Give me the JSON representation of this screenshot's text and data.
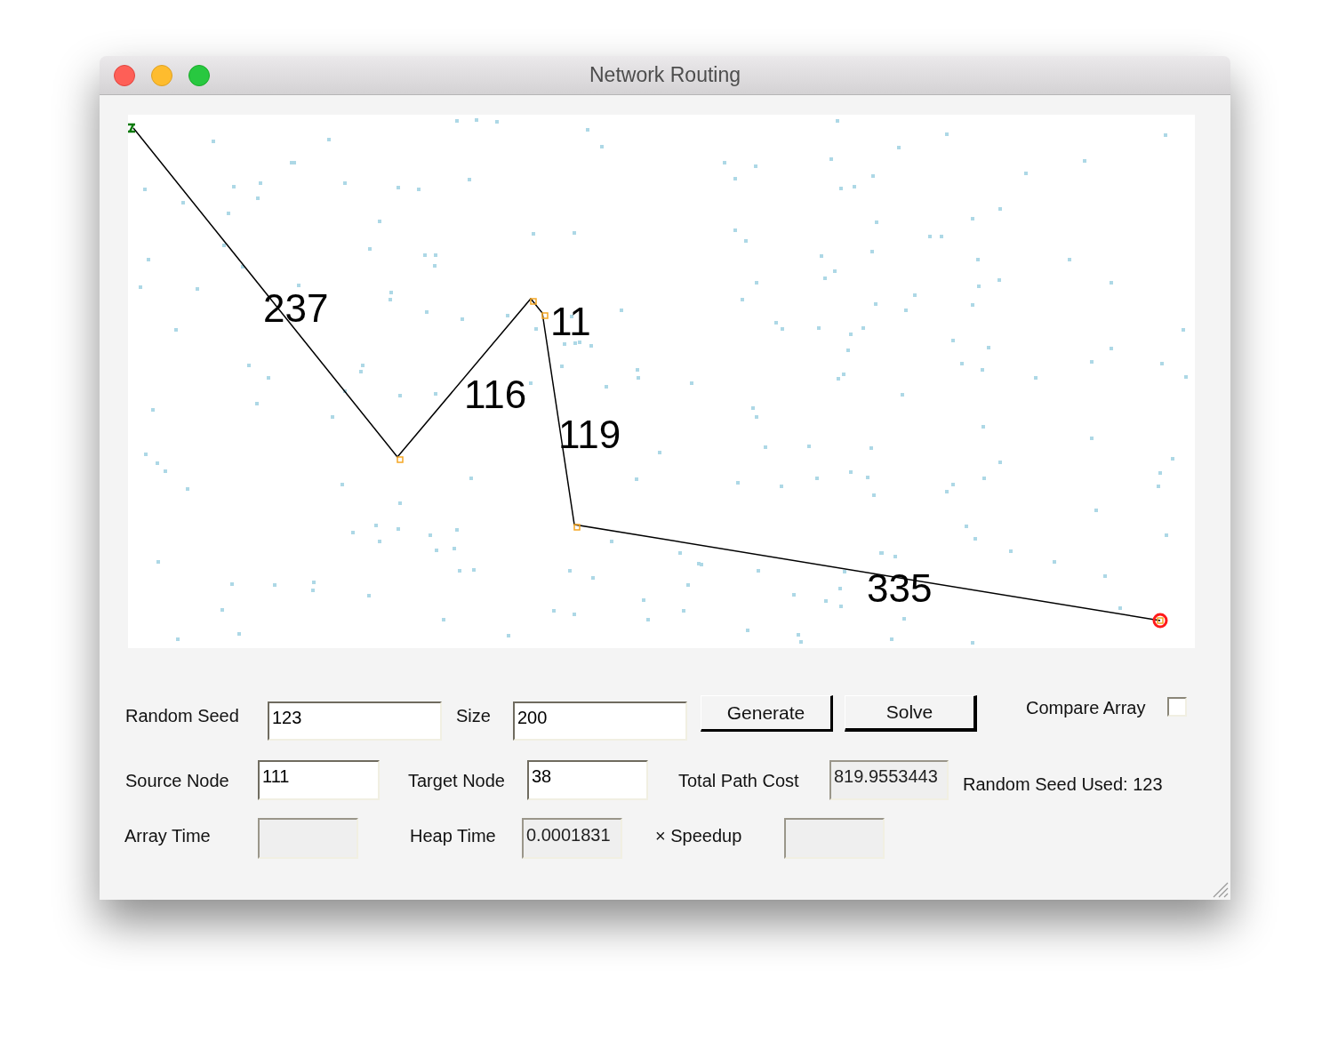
{
  "window": {
    "title": "Network Routing"
  },
  "route": {
    "edges": [
      {
        "cost": "237"
      },
      {
        "cost": "116"
      },
      {
        "cost": "11"
      },
      {
        "cost": "119"
      },
      {
        "cost": "335"
      }
    ]
  },
  "random_seed": {
    "label": "Random Seed",
    "value": "123",
    "readonly": false
  },
  "size": {
    "label": "Size",
    "value": "200",
    "readonly": false
  },
  "buttons": [
    {
      "label": "Generate",
      "default": false
    },
    {
      "label": "Solve",
      "default": true
    }
  ],
  "compare_array": {
    "label": "Compare Array",
    "checked": false
  },
  "source_node": {
    "label": "Source Node",
    "value": "111",
    "readonly": false
  },
  "target_node": {
    "label": "Target Node",
    "value": "38",
    "readonly": false
  },
  "total_path_cost": {
    "label": "Total Path Cost",
    "value": "819.9553443",
    "readonly": true
  },
  "random_seed_used": "Random Seed Used: 123",
  "array_time": {
    "label": "Array Time",
    "readonly": true
  },
  "heap_time": {
    "label": "Heap Time",
    "value": "0.0001831",
    "readonly": true
  },
  "speedup": {
    "label": "× Speedup",
    "readonly": true
  }
}
